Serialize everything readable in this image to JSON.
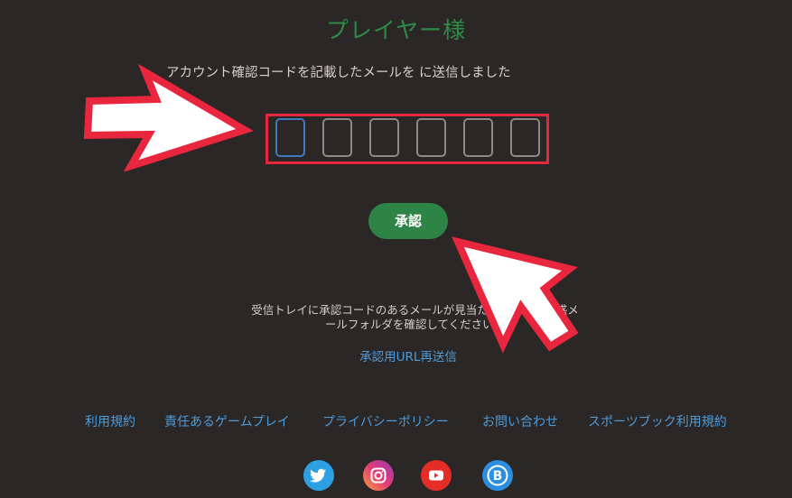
{
  "header": {
    "title": "プレイヤー様"
  },
  "verify": {
    "message": "アカウント確認コードを記載したメールを に送信しました",
    "code_digits": [
      "",
      "",
      "",
      "",
      "",
      ""
    ],
    "approve_label": "承認",
    "hint_line1": "受信トレイに承認コードのあるメールが見当たら　　　　　惑メ",
    "hint_line2": "ールフォルダを確認してください。",
    "resend_label": "承認用URL再送信"
  },
  "footer": {
    "links": [
      "利用規約",
      "責任あるゲームプレイ",
      "プライバシーポリシー",
      "お問い合わせ",
      "スポーツブック利用規約"
    ],
    "social_icons": [
      "twitter-icon",
      "instagram-icon",
      "youtube-icon",
      "blog-icon"
    ]
  },
  "colors": {
    "background": "#2b2726",
    "title_green": "#2e8b47",
    "button_green": "#2d8446",
    "link_blue": "#4d9ad9",
    "highlight_red": "#e8273f"
  }
}
